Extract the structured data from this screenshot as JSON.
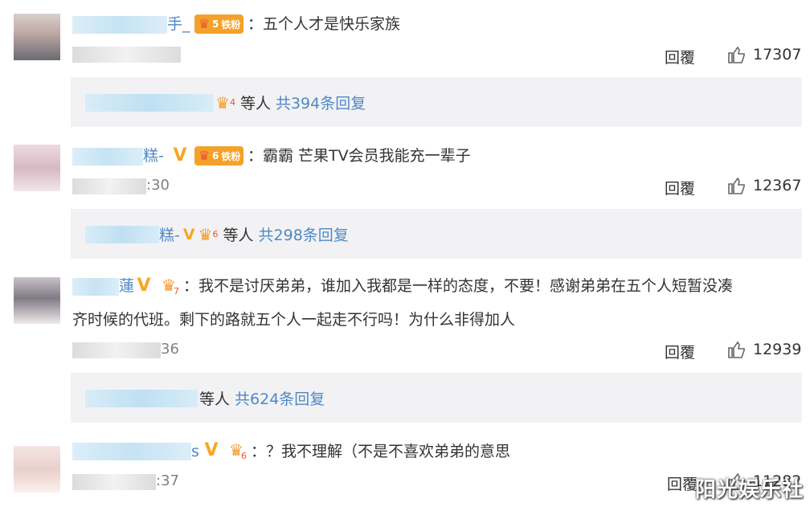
{
  "comments": [
    {
      "name_visible": "手_",
      "badge_level": "5",
      "badge_label": "铁粉",
      "text": "：五个人才是快乐家族",
      "time_visible": "",
      "reply_label": "回覆",
      "likes": "17307",
      "sub_name_tail": "",
      "sub_badge_level": "4",
      "sub_others": "等人",
      "sub_link": "共394条回复"
    },
    {
      "name_visible": "糕-",
      "badge_level": "6",
      "badge_label": "铁粉",
      "text": "：霸霸 芒果TV会员我能充一辈子",
      "time_visible": ":30",
      "reply_label": "回覆",
      "likes": "12367",
      "sub_name_tail": "糕-",
      "sub_badge_level": "6",
      "sub_others": "等人",
      "sub_link": "共298条回复"
    },
    {
      "name_visible": "蓮",
      "badge_level": "7",
      "text_line1": "：我不是讨厌弟弟，谁加入我都是一样的态度，不要！感谢弟弟在五个人短暂没凑",
      "text_line2": "齐时候的代班。剩下的路就五个人一起走不行吗！为什么非得加人",
      "time_visible": "36",
      "reply_label": "回覆",
      "likes": "12939",
      "sub_others": "等人",
      "sub_link": "共624条回复"
    },
    {
      "name_visible": "s",
      "badge_level": "6",
      "text": "：？我不理解（不是不喜欢弟弟的意思",
      "time_visible": ":37",
      "reply_label": "回覆",
      "likes": "11282"
    }
  ],
  "watermark": "阳光娱乐社",
  "colors": {
    "link": "#4f89c5",
    "badge": "#f4a12b",
    "verified": "#f6a623",
    "reply_bg": "#f2f2f5"
  },
  "icons": {
    "like": "thumbs-up-icon",
    "verified": "verified-v-icon",
    "crown": "crown-icon"
  }
}
